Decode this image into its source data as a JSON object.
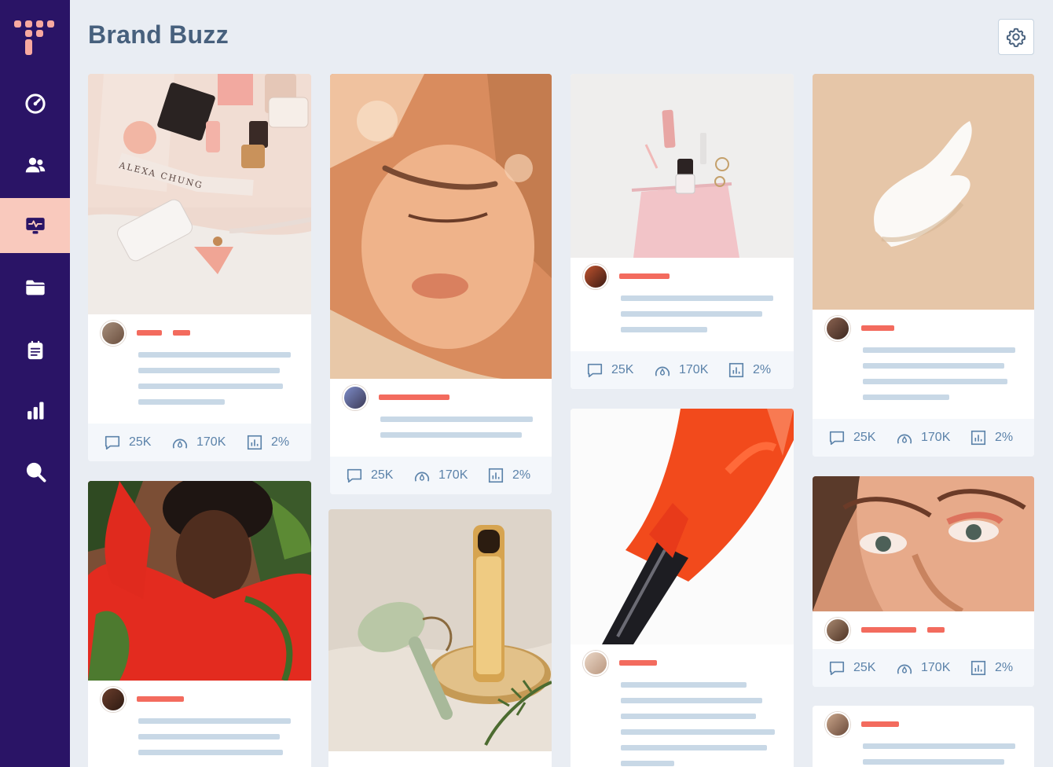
{
  "app": {
    "page_title": "Brand Buzz",
    "colors": {
      "sidebar": "#2a1466",
      "accent": "#f36b5e",
      "active_nav": "#f9c9bd",
      "stat_text": "#5c83aa"
    }
  },
  "sidebar": {
    "items": [
      {
        "icon": "gauge-icon",
        "active": false
      },
      {
        "icon": "users-icon",
        "active": false
      },
      {
        "icon": "monitor-pulse-icon",
        "active": true
      },
      {
        "icon": "folder-icon",
        "active": false
      },
      {
        "icon": "notepad-icon",
        "active": false
      },
      {
        "icon": "bar-chart-icon",
        "active": false
      },
      {
        "icon": "search-icon",
        "active": false
      }
    ]
  },
  "header": {
    "settings_icon": "gear-icon"
  },
  "cards": [
    {
      "stats": {
        "comments": "25K",
        "reach": "170K",
        "engagement": "2%"
      }
    },
    {
      "stats": {
        "comments": "25K",
        "reach": "170K",
        "engagement": "2%"
      }
    },
    {
      "stats": {
        "comments": "25K",
        "reach": "170K",
        "engagement": "2%"
      }
    },
    {
      "stats": {
        "comments": "25K",
        "reach": "170K",
        "engagement": "2%"
      }
    },
    {
      "stats": {
        "comments": "25K",
        "reach": "170K",
        "engagement": "2%"
      }
    }
  ]
}
